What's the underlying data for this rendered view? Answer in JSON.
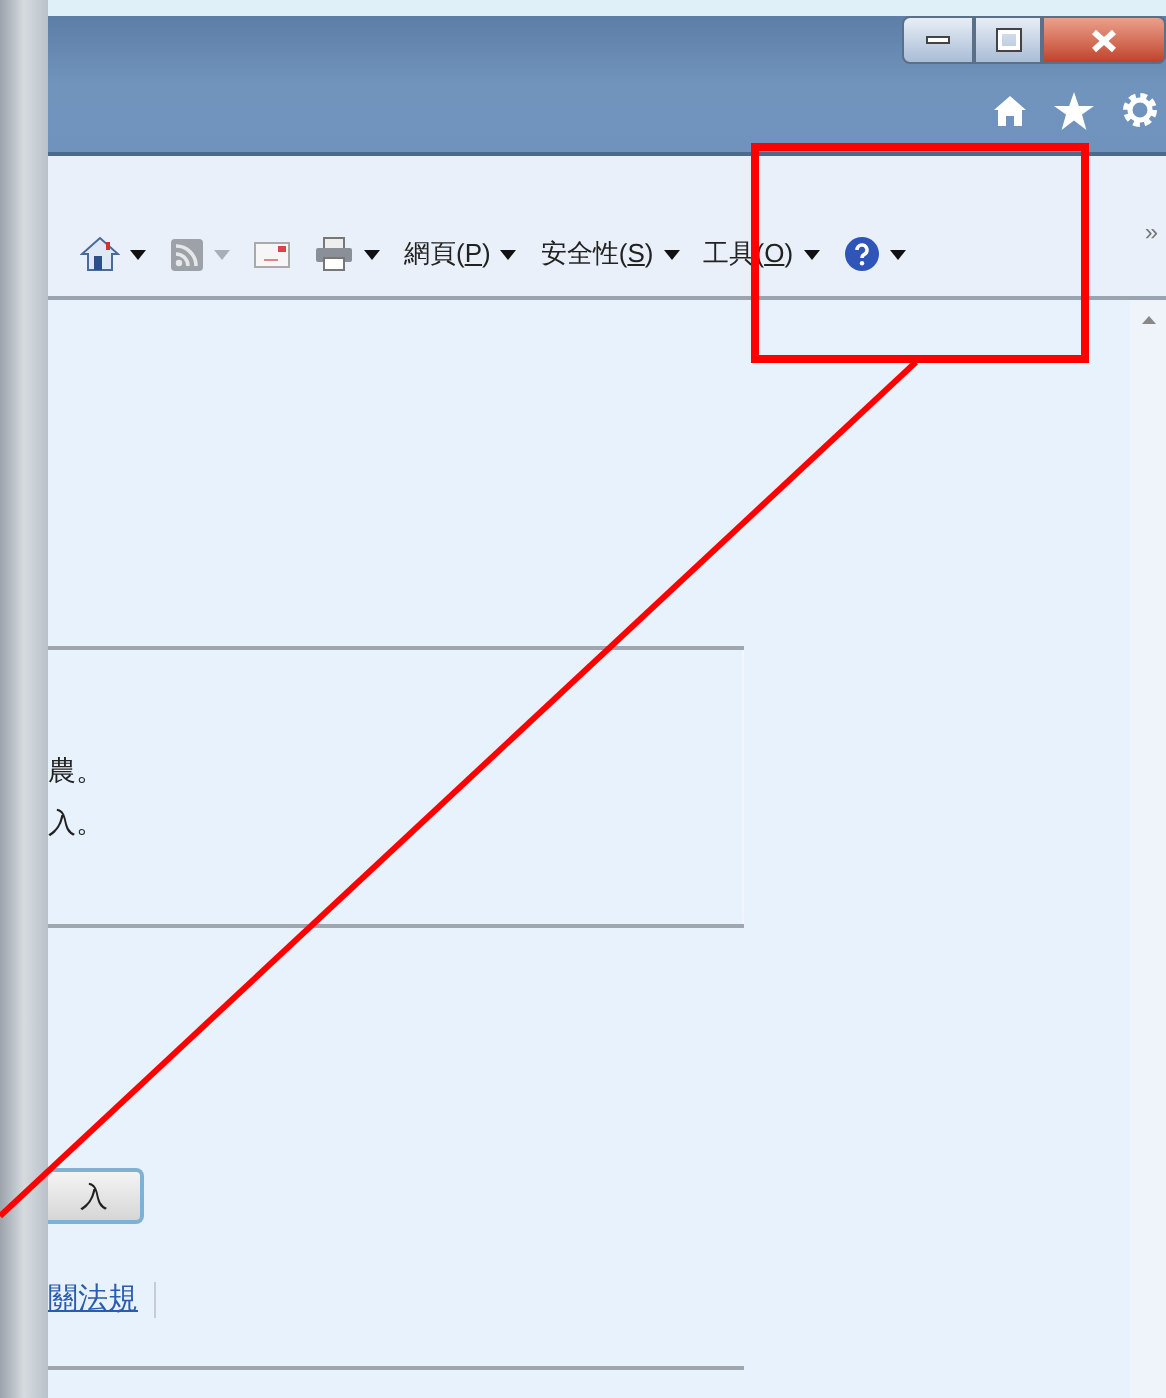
{
  "window_controls": [
    {
      "kind": "minimize"
    },
    {
      "kind": "restore"
    },
    {
      "kind": "close"
    }
  ],
  "command_icons": [
    {
      "kind": "home"
    },
    {
      "kind": "favorites"
    },
    {
      "kind": "settings"
    }
  ],
  "toolbar": [
    {
      "kind": "home",
      "caret": true,
      "disabled": false
    },
    {
      "kind": "feed",
      "caret": true,
      "disabled": true
    },
    {
      "kind": "mail",
      "caret": false,
      "disabled": false
    },
    {
      "kind": "print",
      "caret": true,
      "disabled": false
    },
    {
      "kind": "menu",
      "before": "網頁(",
      "key": "P",
      "after": ")",
      "caret": true,
      "disabled": false
    },
    {
      "kind": "menu",
      "before": "安全性(",
      "key": "S",
      "after": ")",
      "caret": true,
      "disabled": false
    },
    {
      "kind": "menu",
      "before": "工具(",
      "key": "O",
      "after": ")",
      "caret": true,
      "disabled": false
    },
    {
      "kind": "help",
      "caret": true,
      "disabled": false
    }
  ],
  "overflow": "»",
  "content": {
    "notice_lines": [
      "農。",
      "入。"
    ],
    "button": "入",
    "link": "關法規"
  }
}
